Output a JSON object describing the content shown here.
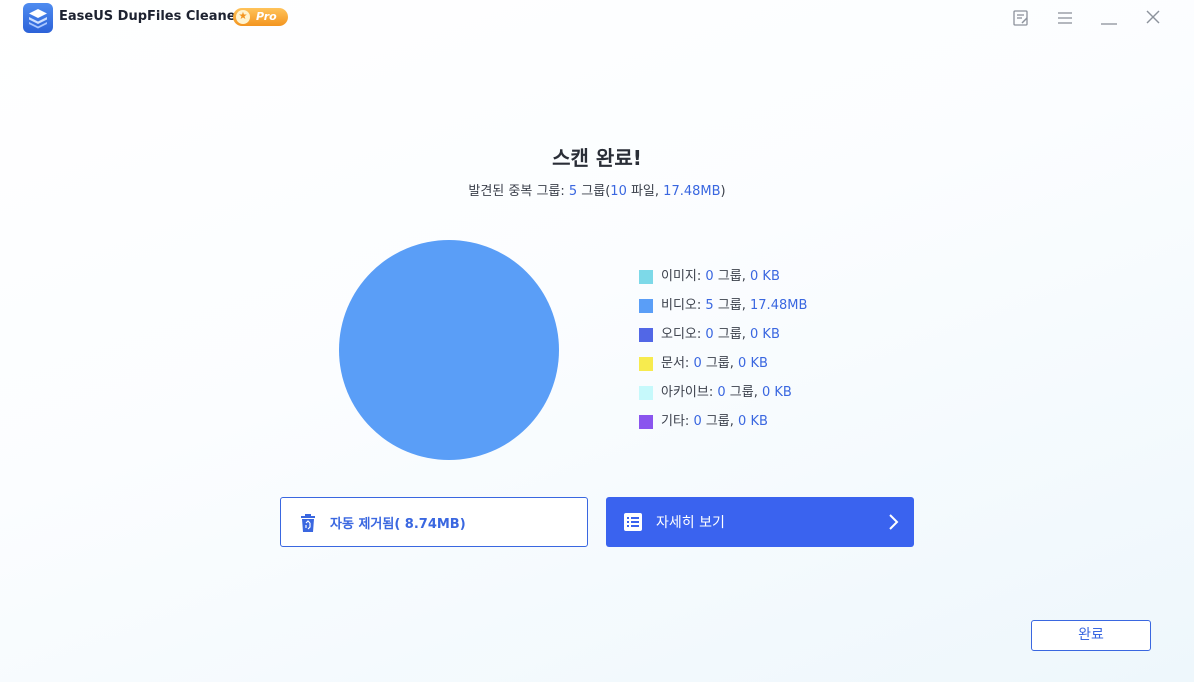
{
  "app": {
    "title": "EaseUS DupFiles Cleaner",
    "badge": "Pro",
    "accent_color": "#3a63ef"
  },
  "window_controls": [
    {
      "name": "feedback-icon"
    },
    {
      "name": "menu-icon"
    },
    {
      "name": "minimize-icon"
    },
    {
      "name": "close-icon"
    }
  ],
  "scan": {
    "title": "스캔 완료!",
    "summary_prefix": "발견된 중복 그룹: ",
    "group_count": "5",
    "group_unit": " 그룹(",
    "file_count": "10",
    "file_unit": " 파일, ",
    "total_size": "17.48MB",
    "summary_suffix": ")"
  },
  "legend": [
    {
      "label": "이미지: ",
      "groups": "0",
      "unit": " 그룹, ",
      "size": "0 KB",
      "color": "#7dd9e8"
    },
    {
      "label": "비디오: ",
      "groups": "5",
      "unit": " 그룹, ",
      "size": "17.48MB",
      "color": "#5a9ef7"
    },
    {
      "label": "오디오: ",
      "groups": "0",
      "unit": " 그룹, ",
      "size": "0 KB",
      "color": "#5267e6"
    },
    {
      "label": "문서: ",
      "groups": "0",
      "unit": " 그룹, ",
      "size": "0 KB",
      "color": "#f7eb4e"
    },
    {
      "label": "아카이브: ",
      "groups": "0",
      "unit": " 그룹, ",
      "size": "0 KB",
      "color": "#c6f9fb"
    },
    {
      "label": "기타: ",
      "groups": "0",
      "unit": " 그룹, ",
      "size": "0 KB",
      "color": "#8a55ee"
    }
  ],
  "chart_data": {
    "type": "pie",
    "categories": [
      "이미지",
      "비디오",
      "오디오",
      "문서",
      "아카이브",
      "기타"
    ],
    "values": [
      0,
      17.48,
      0,
      0,
      0,
      0
    ],
    "colors": [
      "#7dd9e8",
      "#5a9ef7",
      "#5267e6",
      "#f7eb4e",
      "#c6f9fb",
      "#8a55ee"
    ]
  },
  "actions": {
    "auto_remove_label": "자동 제거됨( 8.74MB)",
    "auto_remove_icon": "recycle-bin-icon",
    "detail_label": "자세히 보기",
    "detail_icon": "list-icon",
    "done_label": "완료"
  }
}
